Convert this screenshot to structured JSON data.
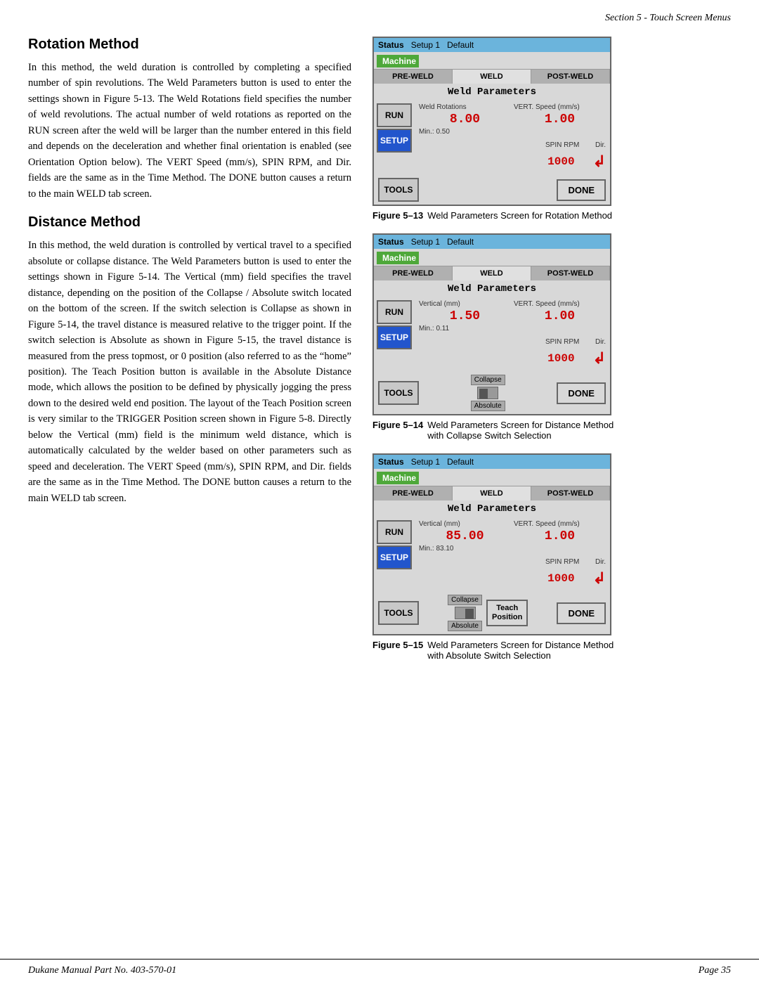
{
  "header": {
    "text": "Section 5 - Touch Screen Menus"
  },
  "footer": {
    "left": "Dukane Manual Part No. 403-570-01",
    "right": "Page   35"
  },
  "rotation_method": {
    "title": "Rotation Method",
    "body": "In this method, the weld duration is controlled by completing a specified number of spin revolutions. The Weld Parameters button is used to enter the settings shown in Figure 5-13. The Weld Rotations field specifies the number of weld revolutions. The actual number of weld rotations as reported on the RUN screen after the weld will be larger than the number entered in this field and depends on the deceleration and whether final orientation is enabled (see Orientation Option below). The VERT Speed (mm/s), SPIN RPM, and Dir. fields are the same as in the Time Method. The DONE button causes a return to the main WELD tab screen."
  },
  "distance_method": {
    "title": "Distance Method",
    "body": "In this method, the weld duration is controlled by vertical travel to a specified absolute or collapse distance. The Weld Parameters button is used to enter the settings shown in Figure 5-14. The Vertical (mm) field specifies the travel distance, depending on the position of the Collapse / Absolute switch located on the bottom of the screen. If the switch selection is Collapse as shown in Figure 5-14, the travel distance is measured relative to the trigger point. If the switch selection is Absolute as shown in Figure 5-15, the travel distance is measured from the press topmost, or 0 position (also referred to as the “home” position). The Teach Position button is available in the Absolute Distance mode, which allows the position to be defined by physically jogging the press down to the desired weld end position. The layout of the Teach Position screen is very similar to the TRIGGER Position screen shown in Figure 5-8. Directly below the Vertical (mm) field is the minimum weld distance, which is automatically calculated by the welder based on other parameters such as speed and deceleration. The VERT Speed (mm/s), SPIN RPM, and Dir. fields are the same as in the Time Method. The DONE button causes a return to the main WELD tab screen."
  },
  "figure13": {
    "label": "Figure 5–13",
    "caption": "Weld Parameters Screen for Rotation Method",
    "screen": {
      "status_label": "Status",
      "setup_label": "Setup 1",
      "default_label": "Default",
      "machine_tab": "Machine",
      "tabs": [
        "PRE-WELD",
        "WELD",
        "POST-WELD"
      ],
      "weld_params_header": "Weld Parameters",
      "field1_label": "Weld Rotations",
      "field1_value": "8.00",
      "field2_label": "VERT. Speed (mm/s)",
      "field2_value": "1.00",
      "min_label": "Min.:",
      "min_value": "0.50",
      "spin_rpm_label": "SPIN RPM",
      "spin_rpm_value": "1000",
      "dir_label": "Dir.",
      "dir_arrow": "↲",
      "run_btn": "RUN",
      "setup_btn": "SETUP",
      "tools_btn": "TOOLS",
      "done_btn": "DONE"
    }
  },
  "figure14": {
    "label": "Figure 5–14",
    "caption": "Weld Parameters Screen for Distance Method with Collapse Switch Selection",
    "screen": {
      "status_label": "Status",
      "setup_label": "Setup 1",
      "default_label": "Default",
      "machine_tab": "Machine",
      "tabs": [
        "PRE-WELD",
        "WELD",
        "POST-WELD"
      ],
      "weld_params_header": "Weld Parameters",
      "field1_label": "Vertical (mm)",
      "field1_value": "1.50",
      "field2_label": "VERT. Speed (mm/s)",
      "field2_value": "1.00",
      "min_label": "Min.:",
      "min_value": "0.11",
      "spin_rpm_label": "SPIN RPM",
      "spin_rpm_value": "1000",
      "dir_label": "Dir.",
      "dir_arrow": "↲",
      "run_btn": "RUN",
      "setup_btn": "SETUP",
      "tools_btn": "TOOLS",
      "done_btn": "DONE",
      "collapse_label": "Collapse",
      "absolute_label": "Absolute"
    }
  },
  "figure15": {
    "label": "Figure 5–15",
    "caption": "Weld Parameters Screen for Distance Method with Absolute Switch Selection",
    "screen": {
      "status_label": "Status",
      "setup_label": "Setup 1",
      "default_label": "Default",
      "machine_tab": "Machine",
      "tabs": [
        "PRE-WELD",
        "WELD",
        "POST-WELD"
      ],
      "weld_params_header": "Weld Parameters",
      "field1_label": "Vertical (mm)",
      "field1_value": "85.00",
      "field2_label": "VERT. Speed (mm/s)",
      "field2_value": "1.00",
      "min_label": "Min.:",
      "min_value": "83.10",
      "spin_rpm_label": "SPIN RPM",
      "spin_rpm_value": "1000",
      "dir_label": "Dir.",
      "dir_arrow": "↲",
      "run_btn": "RUN",
      "setup_btn": "SETUP",
      "tools_btn": "TOOLS",
      "done_btn": "DONE",
      "collapse_label": "Collapse",
      "absolute_label": "Absolute",
      "teach_pos_label": "Teach\nPosition"
    }
  }
}
